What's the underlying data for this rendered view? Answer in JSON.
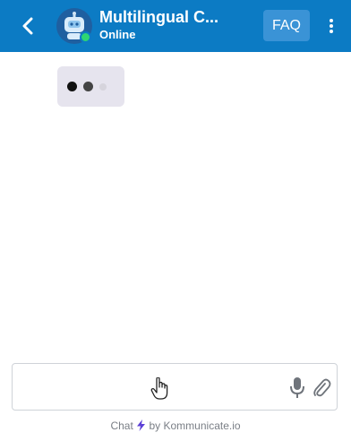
{
  "header": {
    "title": "Multilingual C...",
    "status": "Online",
    "faq_label": "FAQ",
    "accent_color": "#0c7bc4",
    "online_color": "#2ed573",
    "icons": {
      "back": "chevron-left-icon",
      "avatar": "robot-avatar",
      "more": "vertical-dots-icon"
    }
  },
  "chat": {
    "typing_indicator": {
      "dots": [
        "#111111",
        "#444444",
        "#d6d4dc"
      ]
    }
  },
  "composer": {
    "placeholder": "",
    "value": "",
    "icons": {
      "mic": "microphone-icon",
      "attach": "paperclip-icon"
    }
  },
  "footer": {
    "prefix": "Chat",
    "suffix": "by Kommunicate.io",
    "bolt_color": "#5b3fd6"
  }
}
